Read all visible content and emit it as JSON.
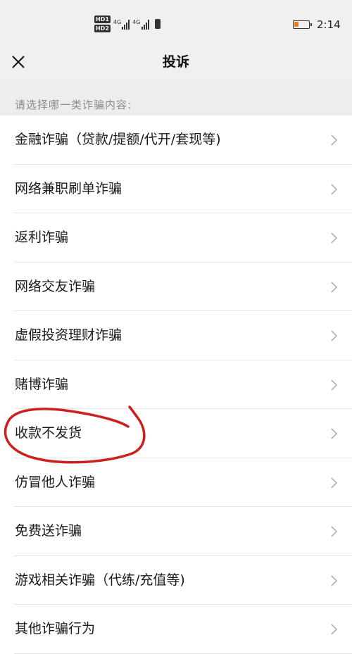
{
  "status_bar": {
    "hd_badges": [
      "HD1",
      "HD2"
    ],
    "network_labels": [
      "4G",
      "4G"
    ],
    "time": "2:14",
    "battery_level": 0.3,
    "battery_color": "#f07a1a"
  },
  "nav": {
    "title": "投诉",
    "close_icon": "close-icon"
  },
  "section": {
    "prompt": "请选择哪一类诈骗内容:"
  },
  "items": [
    {
      "label": "金融诈骗（贷款/提额/代开/套现等)"
    },
    {
      "label": "网络兼职刷单诈骗"
    },
    {
      "label": "返利诈骗"
    },
    {
      "label": "网络交友诈骗"
    },
    {
      "label": "虚假投资理财诈骗"
    },
    {
      "label": "赌博诈骗"
    },
    {
      "label": "收款不发货"
    },
    {
      "label": "仿冒他人诈骗"
    },
    {
      "label": "免费送诈骗"
    },
    {
      "label": "游戏相关诈骗（代练/充值等)"
    },
    {
      "label": "其他诈骗行为"
    }
  ],
  "annotation": {
    "type": "hand-drawn circle",
    "target": "收款不发货",
    "color": "#cc1f1f"
  }
}
